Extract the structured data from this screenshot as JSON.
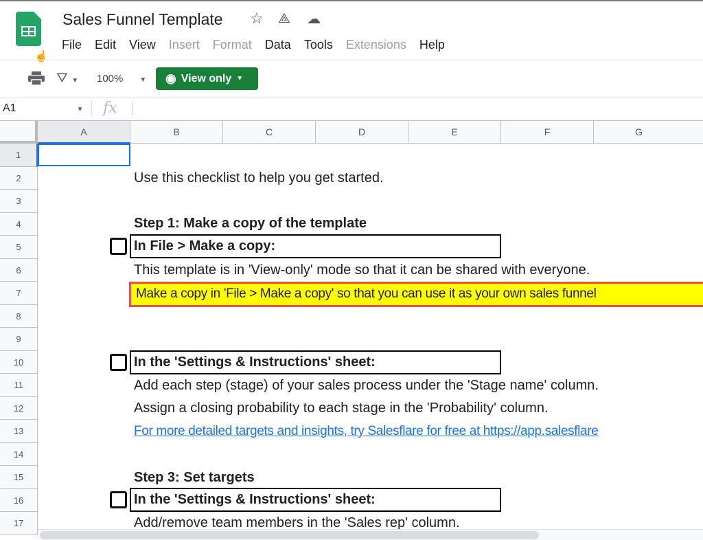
{
  "app": {
    "title": "Sales Funnel Template",
    "icons": [
      "star-icon",
      "drive-add-icon",
      "cloud-saved-icon"
    ]
  },
  "menu": [
    {
      "label": "File",
      "enabled": true
    },
    {
      "label": "Edit",
      "enabled": true
    },
    {
      "label": "View",
      "enabled": true
    },
    {
      "label": "Insert",
      "enabled": false
    },
    {
      "label": "Format",
      "enabled": false
    },
    {
      "label": "Data",
      "enabled": true
    },
    {
      "label": "Tools",
      "enabled": true
    },
    {
      "label": "Extensions",
      "enabled": false
    },
    {
      "label": "Help",
      "enabled": true
    }
  ],
  "toolbar": {
    "zoom": "100%",
    "view_only": "View only",
    "accent": "#188038"
  },
  "formula": {
    "name_box": "A1",
    "fx": "fx",
    "value": ""
  },
  "columns": [
    "A",
    "B",
    "C",
    "D",
    "E",
    "F",
    "G"
  ],
  "rows": [
    "1",
    "2",
    "3",
    "4",
    "5",
    "6",
    "7",
    "8",
    "9",
    "10",
    "11",
    "12",
    "13",
    "14",
    "15",
    "16",
    "17"
  ],
  "cells": {
    "r2": "Use this checklist to help you get started.",
    "r4": "Step 1: Make a copy of the template",
    "r5": "In File > Make a copy:",
    "r6": "This template is in 'View-only' mode so that it can be shared with everyone.",
    "r7": "Make a copy in 'File > Make a copy' so that you can use it as your own sales funnel",
    "r10": "In the 'Settings & Instructions' sheet:",
    "r11": "Add each step (stage) of your sales process under the 'Stage name' column.",
    "r12": "Assign a closing probability to each stage in the 'Probability' column.",
    "r13": "For more detailed targets and insights, try Salesflare for free at https://app.salesflare",
    "r15": "Step 3: Set targets",
    "r16": "In the 'Settings & Instructions' sheet:",
    "r17": "Add/remove team members in the 'Sales rep' column."
  },
  "checkboxes": {
    "r5": false,
    "r10": false,
    "r16": false
  },
  "highlight": {
    "fill": "#ffff00",
    "border": "#e8504a"
  }
}
